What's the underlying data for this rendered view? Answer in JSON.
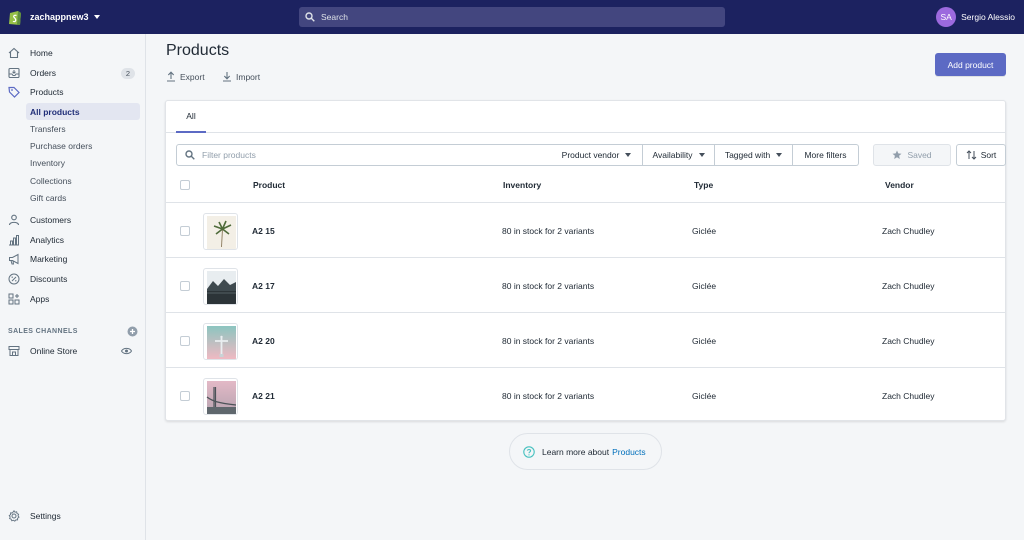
{
  "topbar": {
    "store_name": "zachappnew3",
    "search_placeholder": "Search",
    "user_initials": "SA",
    "user_name": "Sergio Alessio"
  },
  "sidebar": {
    "home": "Home",
    "orders": "Orders",
    "orders_badge": "2",
    "products": "Products",
    "sub_items": [
      "All products",
      "Transfers",
      "Purchase orders",
      "Inventory",
      "Collections",
      "Gift cards"
    ],
    "customers": "Customers",
    "analytics": "Analytics",
    "marketing": "Marketing",
    "discounts": "Discounts",
    "apps": "Apps",
    "sales_channels": "SALES CHANNELS",
    "online_store": "Online Store",
    "settings": "Settings"
  },
  "page": {
    "title": "Products",
    "export_label": "Export",
    "import_label": "Import",
    "add_button": "Add product",
    "tab_all": "All",
    "filter_placeholder": "Filter products",
    "filters": [
      "Product vendor",
      "Availability",
      "Tagged with",
      "More filters"
    ],
    "saved_label": "Saved",
    "sort_label": "Sort"
  },
  "table": {
    "headers": [
      "Product",
      "Inventory",
      "Type",
      "Vendor"
    ],
    "rows": [
      {
        "name": "A2 15",
        "inventory": "80 in stock for 2 variants",
        "type": "Giclée",
        "vendor": "Zach Chudley"
      },
      {
        "name": "A2 17",
        "inventory": "80 in stock for 2 variants",
        "type": "Giclée",
        "vendor": "Zach Chudley"
      },
      {
        "name": "A2 20",
        "inventory": "80 in stock for 2 variants",
        "type": "Giclée",
        "vendor": "Zach Chudley"
      },
      {
        "name": "A2 21",
        "inventory": "80 in stock for 2 variants",
        "type": "Giclée",
        "vendor": "Zach Chudley"
      }
    ]
  },
  "footer": {
    "learn_text": "Learn more about",
    "learn_link": "Products"
  },
  "colors": {
    "topbar": "#1c2260",
    "accent": "#5c6ac4",
    "link": "#006fbb"
  }
}
